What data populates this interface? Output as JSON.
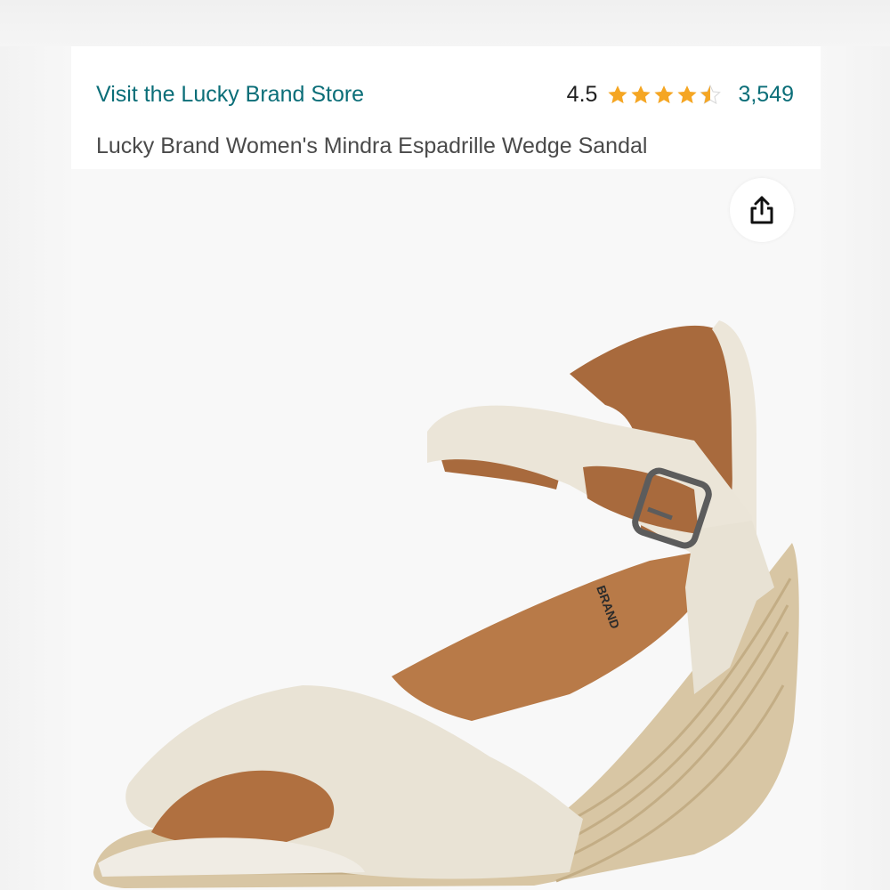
{
  "header": {
    "store_link": "Visit the Lucky Brand Store",
    "rating_value": "4.5",
    "rating_stars": 4.5,
    "review_count": "3,549",
    "product_title": "Lucky Brand Women's Mindra Espadrille Wedge Sandal"
  },
  "share_button": {
    "icon": "share-icon"
  },
  "product_image": {
    "subject": "sandal-image",
    "sole_print": "BRAND"
  },
  "colors": {
    "link": "#0b6e78",
    "star": "#f5a623",
    "text": "#4a4a4a"
  }
}
